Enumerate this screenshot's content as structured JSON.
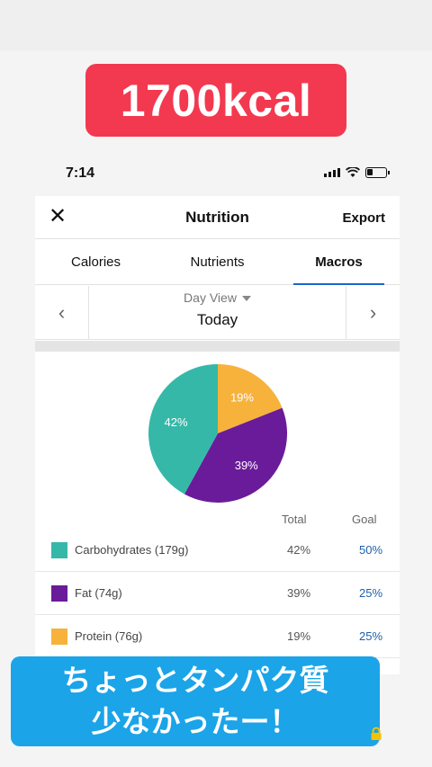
{
  "story": {
    "kcal_badge": "1700kcal",
    "caption_line1": "ちょっとタンパク質",
    "caption_line2": "少なかったー！"
  },
  "status_bar": {
    "time": "7:14"
  },
  "nav": {
    "title": "Nutrition",
    "export_label": "Export"
  },
  "tabs": [
    {
      "label": "Calories",
      "active": false
    },
    {
      "label": "Nutrients",
      "active": false
    },
    {
      "label": "Macros",
      "active": true
    }
  ],
  "day_selector": {
    "view_label": "Day View",
    "date_label": "Today"
  },
  "chart_data": {
    "type": "pie",
    "slices": [
      {
        "name": "Protein",
        "value": 19,
        "label": "19%",
        "color": "#f7b23b"
      },
      {
        "name": "Fat",
        "value": 39,
        "label": "39%",
        "color": "#6a1b9a"
      },
      {
        "name": "Carbohydrates",
        "value": 42,
        "label": "42%",
        "color": "#35b8a8"
      }
    ]
  },
  "table": {
    "headers": {
      "total": "Total",
      "goal": "Goal"
    },
    "rows": [
      {
        "label": "Carbohydrates (179g)",
        "total": "42%",
        "goal": "50%",
        "color": "#35b8a8"
      },
      {
        "label": "Fat (74g)",
        "total": "39%",
        "goal": "25%",
        "color": "#6a1b9a"
      },
      {
        "label": "Protein (76g)",
        "total": "19%",
        "goal": "25%",
        "color": "#f7b23b"
      }
    ]
  }
}
